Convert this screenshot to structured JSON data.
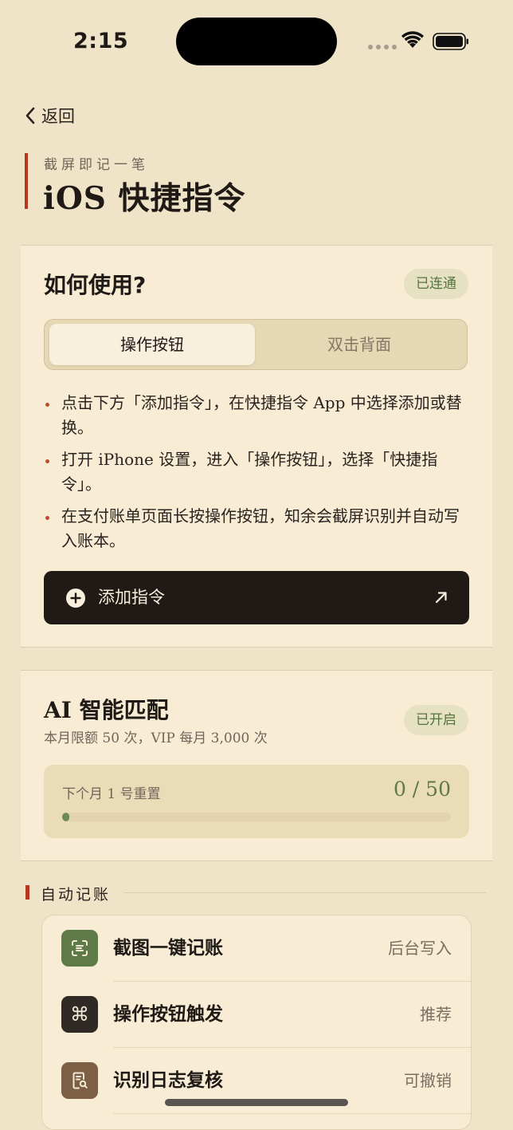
{
  "status_bar": {
    "time": "2:15"
  },
  "nav": {
    "back_label": "返回"
  },
  "header": {
    "subtitle": "截屏即记一笔",
    "title": "iOS 快捷指令"
  },
  "how_to": {
    "title": "如何使用?",
    "badge": "已连通",
    "tabs": [
      {
        "label": "操作按钮",
        "active": true
      },
      {
        "label": "双击背面",
        "active": false
      }
    ],
    "steps": [
      "点击下方「添加指令」，在快捷指令 App 中选择添加或替换。",
      "打开 iPhone 设置，进入「操作按钮」，选择「快捷指令」。",
      "在支付账单页面长按操作按钮，知余会截屏识别并自动写入账本。"
    ],
    "add_button_label": "添加指令"
  },
  "ai_match": {
    "title": "AI 智能匹配",
    "subtitle": "本月限额 50 次，VIP 每月 3,000 次",
    "badge": "已开启",
    "reset_text": "下个月 1 号重置",
    "used": 0,
    "limit": 50,
    "usage_text": "0 / 50"
  },
  "auto_record": {
    "section_title": "自动记账",
    "items": [
      {
        "label": "截图一键记账",
        "value": "后台写入",
        "icon": "scan-text-icon",
        "icon_bg": "#5e7a46"
      },
      {
        "label": "操作按钮触发",
        "value": "推荐",
        "icon": "command-icon",
        "icon_bg": "#2f2a26"
      },
      {
        "label": "识别日志复核",
        "value": "可撤销",
        "icon": "document-search-icon",
        "icon_bg": "#7d5f45"
      }
    ]
  },
  "colors": {
    "background": "#f0e4c8",
    "card": "#f8ecd4",
    "accent_red": "#b4391e",
    "accent_green": "#5e7a46",
    "dark": "#1f1a16"
  }
}
